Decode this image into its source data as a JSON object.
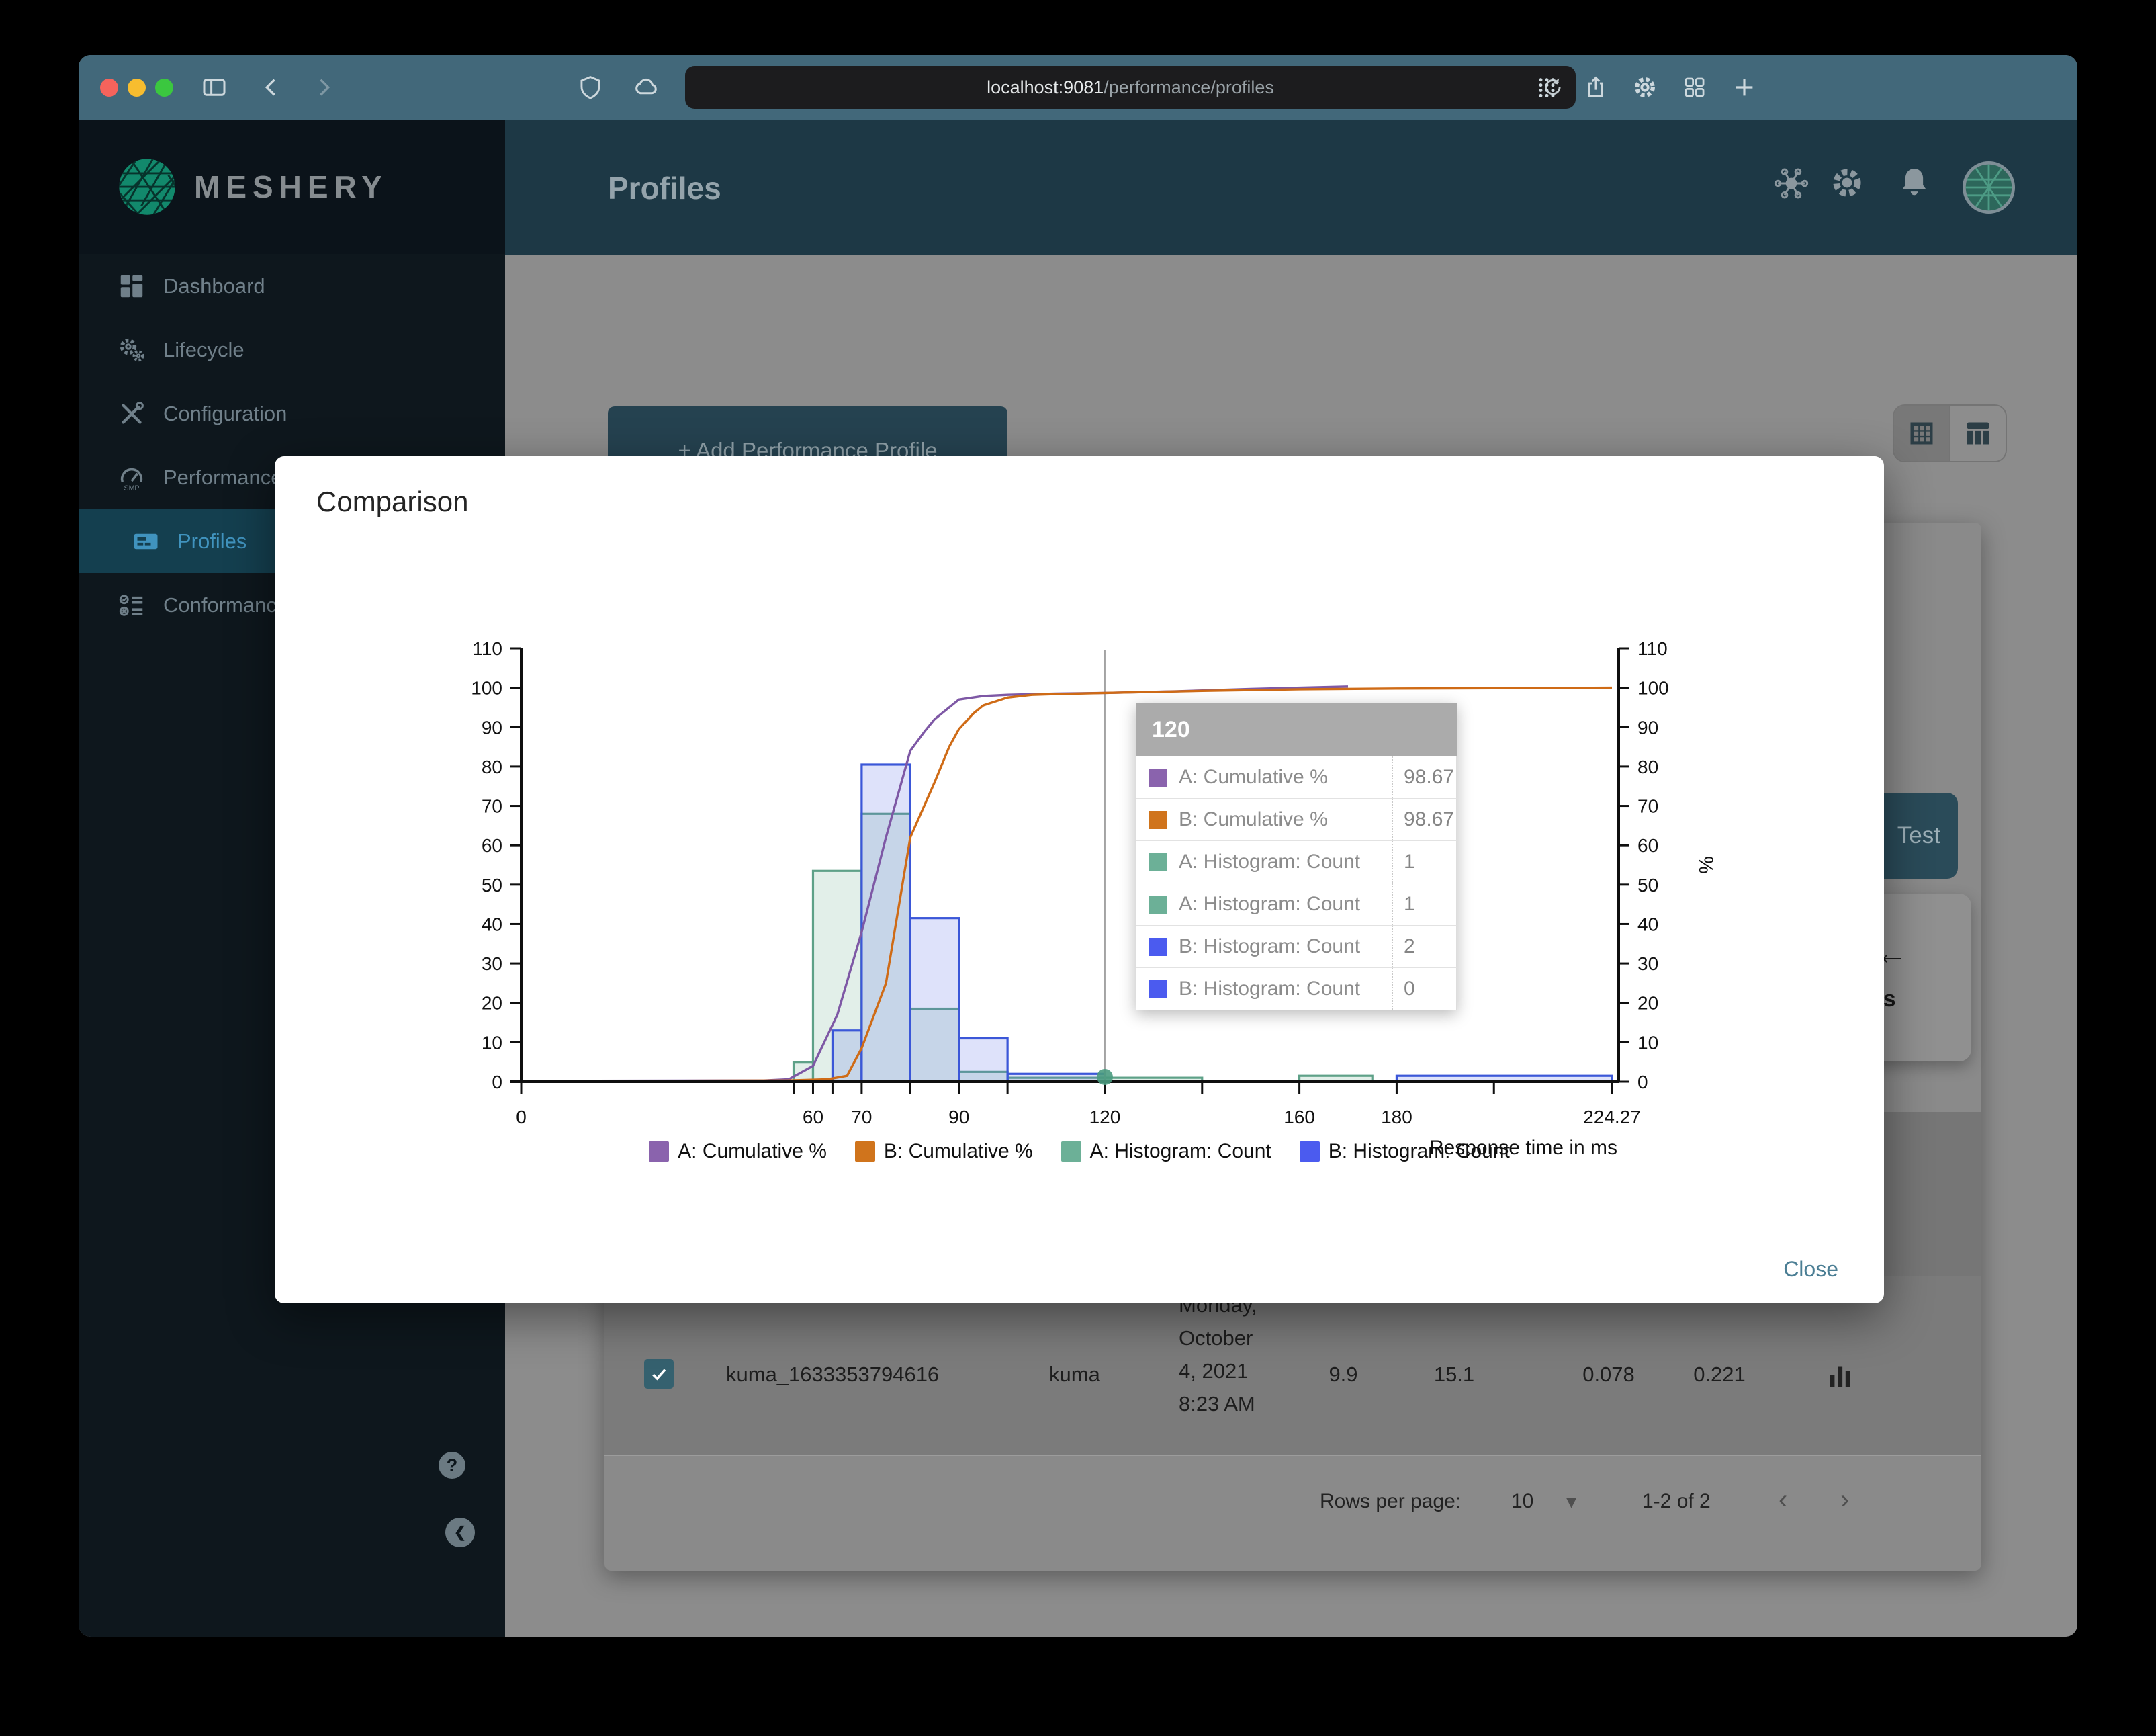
{
  "browser": {
    "url_host": "localhost:9081",
    "url_path": "/performance/profiles"
  },
  "sidebar": {
    "brand": "MESHERY",
    "items": [
      {
        "label": "Dashboard",
        "active": false
      },
      {
        "label": "Lifecycle",
        "active": false
      },
      {
        "label": "Configuration",
        "active": false
      },
      {
        "label": "Performance",
        "active": false
      },
      {
        "label": "Profiles",
        "active": true
      },
      {
        "label": "Conformance",
        "active": false
      }
    ],
    "help_glyph": "?",
    "collapse_glyph": "❮"
  },
  "header": {
    "title": "Profiles"
  },
  "page": {
    "add_profile_button": "+ Add Performance Profile",
    "test_button_label": "Test",
    "details_text_fragment": "ails",
    "back_arrow_glyph": "←",
    "row": {
      "name": "kuma_1633353794616",
      "mesh": "kuma",
      "date_lines": [
        "Monday,",
        "October",
        "4, 2021",
        "8:23 AM"
      ],
      "qps": "9.9",
      "duration": "15.1",
      "p50": "0.078",
      "p99": "0.221"
    },
    "pagination": {
      "rows_per_page_label": "Rows per page:",
      "rows_per_page_value": "10",
      "caret_glyph": "▾",
      "range_text": "1-2 of 2",
      "prev_glyph": "‹",
      "next_glyph": "›"
    }
  },
  "modal": {
    "title": "Comparison",
    "close_label": "Close",
    "tooltip": {
      "header": "120",
      "rows": [
        {
          "swatch": "#8a63ad",
          "label": "A: Cumulative %",
          "value": "98.67"
        },
        {
          "swatch": "#d0741c",
          "label": "B: Cumulative %",
          "value": "98.67"
        },
        {
          "swatch": "#6cb097",
          "label": "A: Histogram: Count",
          "value": "1"
        },
        {
          "swatch": "#6cb097",
          "label": "A: Histogram: Count",
          "value": "1"
        },
        {
          "swatch": "#4b5bef",
          "label": "B: Histogram: Count",
          "value": "2"
        },
        {
          "swatch": "#4b5bef",
          "label": "B: Histogram: Count",
          "value": "0"
        }
      ]
    },
    "legend": [
      {
        "label": "A: Cumulative %",
        "color": "#8a63ad"
      },
      {
        "label": "B: Cumulative %",
        "color": "#d0741c"
      },
      {
        "label": "A: Histogram: Count",
        "color": "#6cb097"
      },
      {
        "label": "B: Histogram: Count",
        "color": "#4b5bef"
      }
    ]
  },
  "chart_data": {
    "type": "histogram+line",
    "title": "",
    "xlabel": "Response time in ms",
    "ylabel_right": "%",
    "xlim": [
      0,
      224.27
    ],
    "ylim": [
      0,
      110
    ],
    "grid": false,
    "legend_position": "bottom",
    "y_ticks": [
      0,
      10,
      20,
      30,
      40,
      50,
      60,
      70,
      80,
      90,
      100,
      110
    ],
    "x_major_ticks": [
      0,
      60,
      70,
      90,
      120,
      160,
      180,
      224.27
    ],
    "x_major_labels": [
      "0",
      "60",
      "70",
      "90",
      "120",
      "160",
      "180",
      "224.27"
    ],
    "x_minor_ticks": [
      56,
      64,
      80,
      100,
      140,
      200
    ],
    "crosshair_x": 120,
    "marker": {
      "x": 120,
      "y": 1.2,
      "color": "#4a9b80"
    },
    "series": [
      {
        "name": "A: Histogram: Count",
        "type": "histogram",
        "color": "#5ea188",
        "fill": "rgba(122,181,156,0.22)",
        "bins": [
          [
            56,
            60,
            5
          ],
          [
            60,
            70,
            53.5
          ],
          [
            70,
            80,
            68
          ],
          [
            80,
            90,
            18.5
          ],
          [
            90,
            100,
            2.5
          ],
          [
            100,
            140,
            1
          ],
          [
            160,
            175,
            1.5
          ]
        ]
      },
      {
        "name": "B: Histogram: Count",
        "type": "histogram",
        "color": "#3b57d8",
        "fill": "rgba(92,110,230,0.20)",
        "bins": [
          [
            64,
            70,
            13
          ],
          [
            70,
            80,
            80.5
          ],
          [
            80,
            90,
            41.5
          ],
          [
            90,
            100,
            11
          ],
          [
            100,
            120,
            2
          ],
          [
            180,
            224.27,
            1.5
          ]
        ]
      },
      {
        "name": "A: Cumulative %",
        "type": "line",
        "color": "#7e58a5",
        "points": [
          [
            0,
            0.2
          ],
          [
            50,
            0.3
          ],
          [
            55,
            0.6
          ],
          [
            60,
            4
          ],
          [
            65,
            17
          ],
          [
            70,
            38
          ],
          [
            75,
            62
          ],
          [
            80,
            84
          ],
          [
            83,
            89
          ],
          [
            85,
            92
          ],
          [
            90,
            97
          ],
          [
            95,
            97.9
          ],
          [
            100,
            98.2
          ],
          [
            110,
            98.5
          ],
          [
            120,
            98.67
          ],
          [
            135,
            99.1
          ],
          [
            150,
            99.7
          ],
          [
            170,
            100.3
          ]
        ]
      },
      {
        "name": "B: Cumulative %",
        "type": "line",
        "color": "#cf6b16",
        "points": [
          [
            0,
            0.1
          ],
          [
            55,
            0.3
          ],
          [
            63,
            0.6
          ],
          [
            67,
            1.5
          ],
          [
            70,
            8.5
          ],
          [
            75,
            25
          ],
          [
            80,
            62
          ],
          [
            85,
            76
          ],
          [
            88,
            85
          ],
          [
            90,
            89.5
          ],
          [
            93,
            93.5
          ],
          [
            95,
            95.5
          ],
          [
            100,
            97.5
          ],
          [
            105,
            98.2
          ],
          [
            110,
            98.4
          ],
          [
            120,
            98.67
          ],
          [
            140,
            99.2
          ],
          [
            160,
            99.6
          ],
          [
            180,
            99.8
          ],
          [
            224.27,
            100
          ]
        ]
      }
    ]
  }
}
